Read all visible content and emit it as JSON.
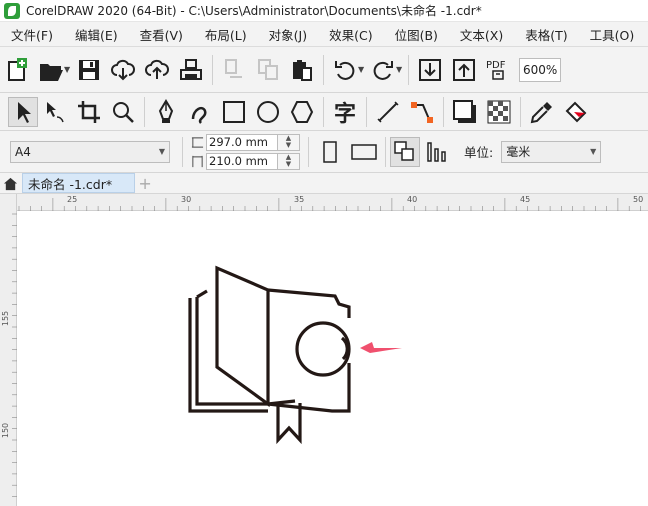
{
  "titlebar": {
    "app_icon": "coreldraw-icon",
    "title": "CorelDRAW 2020 (64-Bit) - C:\\Users\\Administrator\\Documents\\未命名 -1.cdr*"
  },
  "menubar": {
    "items": [
      "文件(F)",
      "编辑(E)",
      "查看(V)",
      "布局(L)",
      "对象(J)",
      "效果(C)",
      "位图(B)",
      "文本(X)",
      "表格(T)",
      "工具(O)"
    ]
  },
  "standard_toolbar": {
    "buttons": [
      "new-document-icon",
      "open-folder-icon",
      "save-icon",
      "cloud-download-icon",
      "cloud-upload-icon",
      "print-icon",
      "cut-icon",
      "copy-icon",
      "paste-icon",
      "undo-icon",
      "redo-icon",
      "import-icon",
      "export-icon",
      "pdf-icon"
    ],
    "pdf_label": "PDF",
    "zoom": "600%"
  },
  "tools_toolbar": {
    "buttons": [
      "pick-tool-icon",
      "shape-tool-icon",
      "crop-tool-icon",
      "zoom-tool-icon",
      "pen-tool-icon",
      "artistic-media-icon",
      "rectangle-tool-icon",
      "ellipse-tool-icon",
      "polygon-tool-icon",
      "text-tool-icon",
      "line-tool-icon",
      "connector-tool-icon",
      "drop-shadow-icon",
      "transparency-icon",
      "eyedropper-icon",
      "fill-icon"
    ],
    "text_tool_glyph": "字"
  },
  "property_bar": {
    "page_size": "A4",
    "width": "297.0 mm",
    "height": "210.0 mm",
    "units_label": "单位:",
    "units_value": "毫米"
  },
  "tabs": {
    "active": "未命名 -1.cdr*",
    "add": "+"
  },
  "rulers": {
    "horizontal_labels": [
      "25",
      "30",
      "35",
      "40",
      "45",
      "50"
    ],
    "vertical_labels": [
      "155",
      "150"
    ]
  },
  "colors": {
    "accent": "#2f9e3a",
    "drawing_stroke": "#231815",
    "arrow": "#f0506e",
    "tab_active": "#d8e8f8"
  }
}
